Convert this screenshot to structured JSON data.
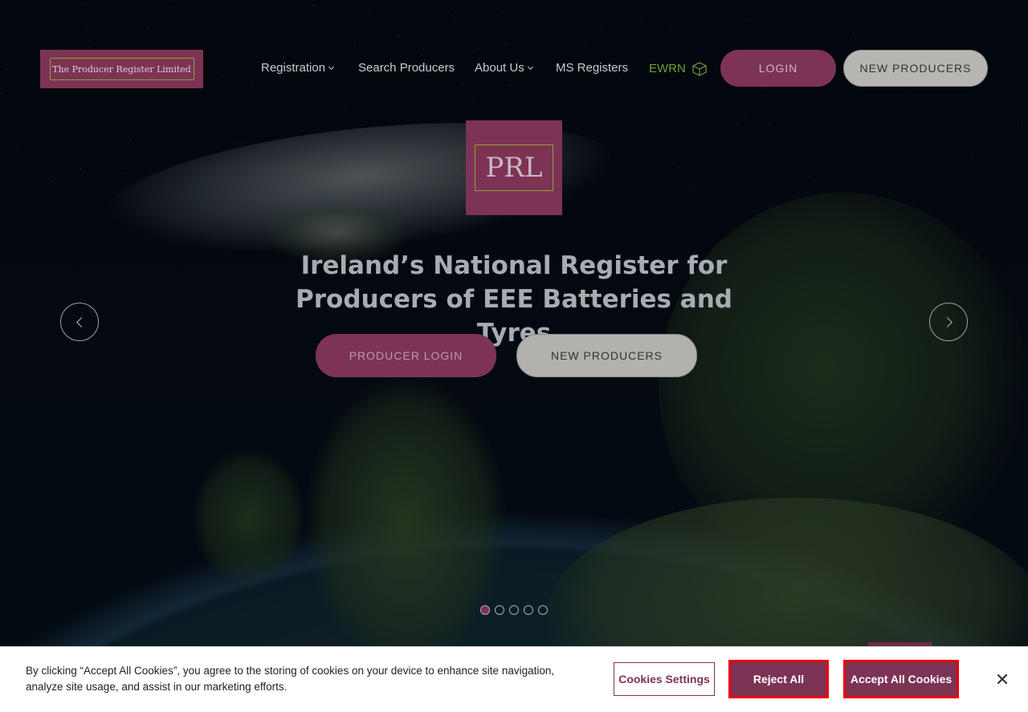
{
  "header": {
    "logo_text": "The Producer Register Limited",
    "nav": [
      {
        "label": "Registration",
        "has_dropdown": true
      },
      {
        "label": "Search Producers",
        "has_dropdown": false
      },
      {
        "label": "About Us",
        "has_dropdown": true
      },
      {
        "label": "MS Registers",
        "has_dropdown": false
      },
      {
        "label": "EWRN",
        "icon": "ewrn-cube-icon"
      }
    ],
    "login_label": "LOGIN",
    "new_producers_label": "NEW PRODUCERS"
  },
  "hero": {
    "logo_text": "PRL",
    "headline_line1": "Ireland’s National Register for",
    "headline_line2": "Producers of EEE Batteries and Tyres",
    "producer_login_label": "PRODUCER LOGIN",
    "new_producers_label": "NEW PRODUCERS",
    "slide_count": 5,
    "active_slide": 1
  },
  "cookie_banner": {
    "text": "By clicking “Accept All Cookies”, you agree to the storing of cookies on your device to enhance site navigation, analyze site usage, and assist in our marketing efforts.",
    "settings_label": "Cookies Settings",
    "reject_label": "Reject All",
    "accept_label": "Accept All Cookies",
    "close_icon": "close-icon"
  },
  "colors": {
    "brand": "#7d3354",
    "accent_green": "#8ea23d",
    "highlight": "#ee0000"
  }
}
